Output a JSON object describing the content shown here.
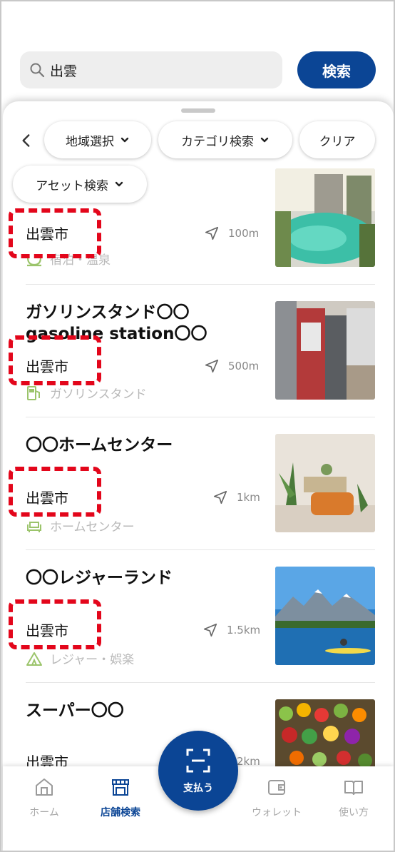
{
  "search": {
    "query": "出雲",
    "button_label": "検索"
  },
  "filters": {
    "region": "地域選択",
    "category": "カテゴリ検索",
    "clear": "クリア",
    "asset": "アセット検索"
  },
  "results": [
    {
      "title": "",
      "city": "出雲市",
      "distance": "100m",
      "category": "宿泊・温泉"
    },
    {
      "title": "ガソリンスタンド〇〇",
      "title2": "gasoline station〇〇",
      "city": "出雲市",
      "distance": "500m",
      "category": "ガソリンスタンド"
    },
    {
      "title": "〇〇ホームセンター",
      "city": "出雲市",
      "distance": "1km",
      "category": "ホームセンター"
    },
    {
      "title": "〇〇レジャーランド",
      "city": "出雲市",
      "distance": "1.5km",
      "category": "レジャー・娯楽"
    },
    {
      "title": "スーパー〇〇",
      "city": "出雲市",
      "distance": "2km",
      "category": ""
    }
  ],
  "nav": {
    "home": "ホーム",
    "store_search": "店舗検索",
    "pay": "支払う",
    "wallet": "ウォレット",
    "howto": "使い方"
  },
  "colors": {
    "brand": "#0b4595",
    "highlight": "#e3061b",
    "muted": "#b9b9b9"
  }
}
